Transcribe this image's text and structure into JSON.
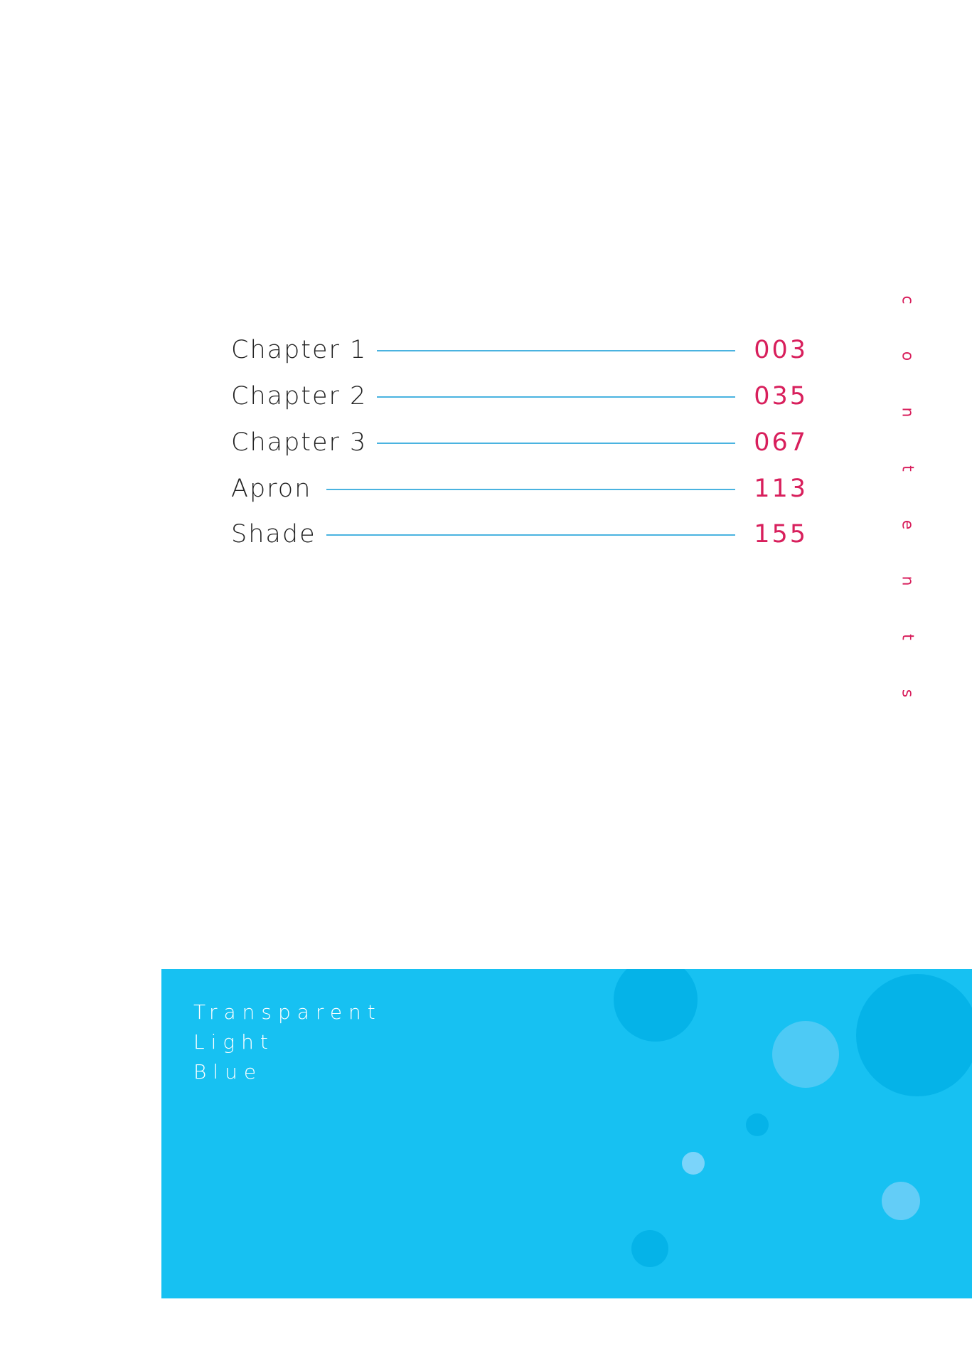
{
  "toc": [
    {
      "title": "Chapter 1",
      "page": "003"
    },
    {
      "title": "Chapter 2",
      "page": "035"
    },
    {
      "title": "Chapter 3",
      "page": "067"
    },
    {
      "title": "Apron",
      "page": "113"
    },
    {
      "title": "Shade",
      "page": "155"
    }
  ],
  "contents_heading": [
    "c",
    "o",
    "n",
    "t",
    "e",
    "n",
    "t",
    "s"
  ],
  "banner": {
    "lines": [
      "Transparent",
      "Light",
      "Blue"
    ]
  },
  "colors": {
    "accent": "#d81f5c",
    "rule": "#4ab3e0",
    "banner": "#17c1f2",
    "bubble_dark": "#05b3e8",
    "bubble_light": "#4dcaf5"
  }
}
